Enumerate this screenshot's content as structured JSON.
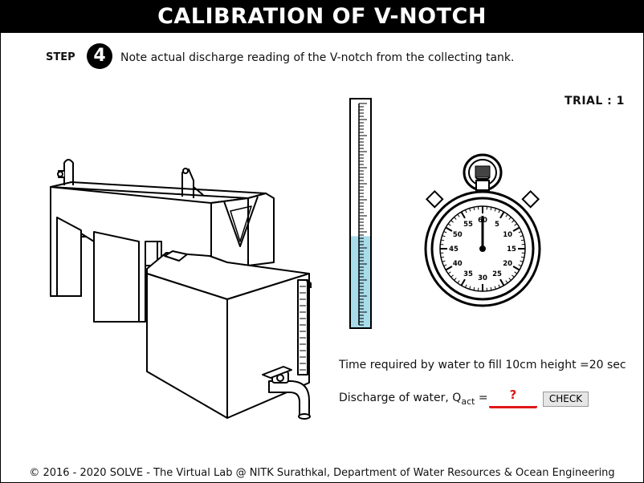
{
  "header": {
    "title": "CALIBRATION OF V-NOTCH"
  },
  "step": {
    "label": "STEP",
    "number": "4",
    "instruction": "Note actual discharge reading of the V-notch from the collecting tank."
  },
  "trial": {
    "label": "TRIAL : 1"
  },
  "stopwatch": {
    "dial_numbers": [
      "60",
      "5",
      "10",
      "15",
      "20",
      "25",
      "30",
      "35",
      "40",
      "45",
      "50",
      "55"
    ],
    "hand_reading": "60"
  },
  "scale": {
    "water_level_fraction": 0.4
  },
  "readings": {
    "time_text": "Time required by water to fill 10cm height =20 sec",
    "discharge_label": "Discharge of water, Q",
    "discharge_sub": "act",
    "discharge_eq": " =",
    "answer_placeholder": "?"
  },
  "actions": {
    "check_label": "CHECK"
  },
  "footer": {
    "text": "© 2016 - 2020 SOLVE - The Virtual Lab @ NITK Surathkal, Department of Water Resources & Ocean Engineering"
  },
  "colors": {
    "water": "#a8dcea",
    "answer": "#e01818",
    "header_bg": "#000000"
  }
}
